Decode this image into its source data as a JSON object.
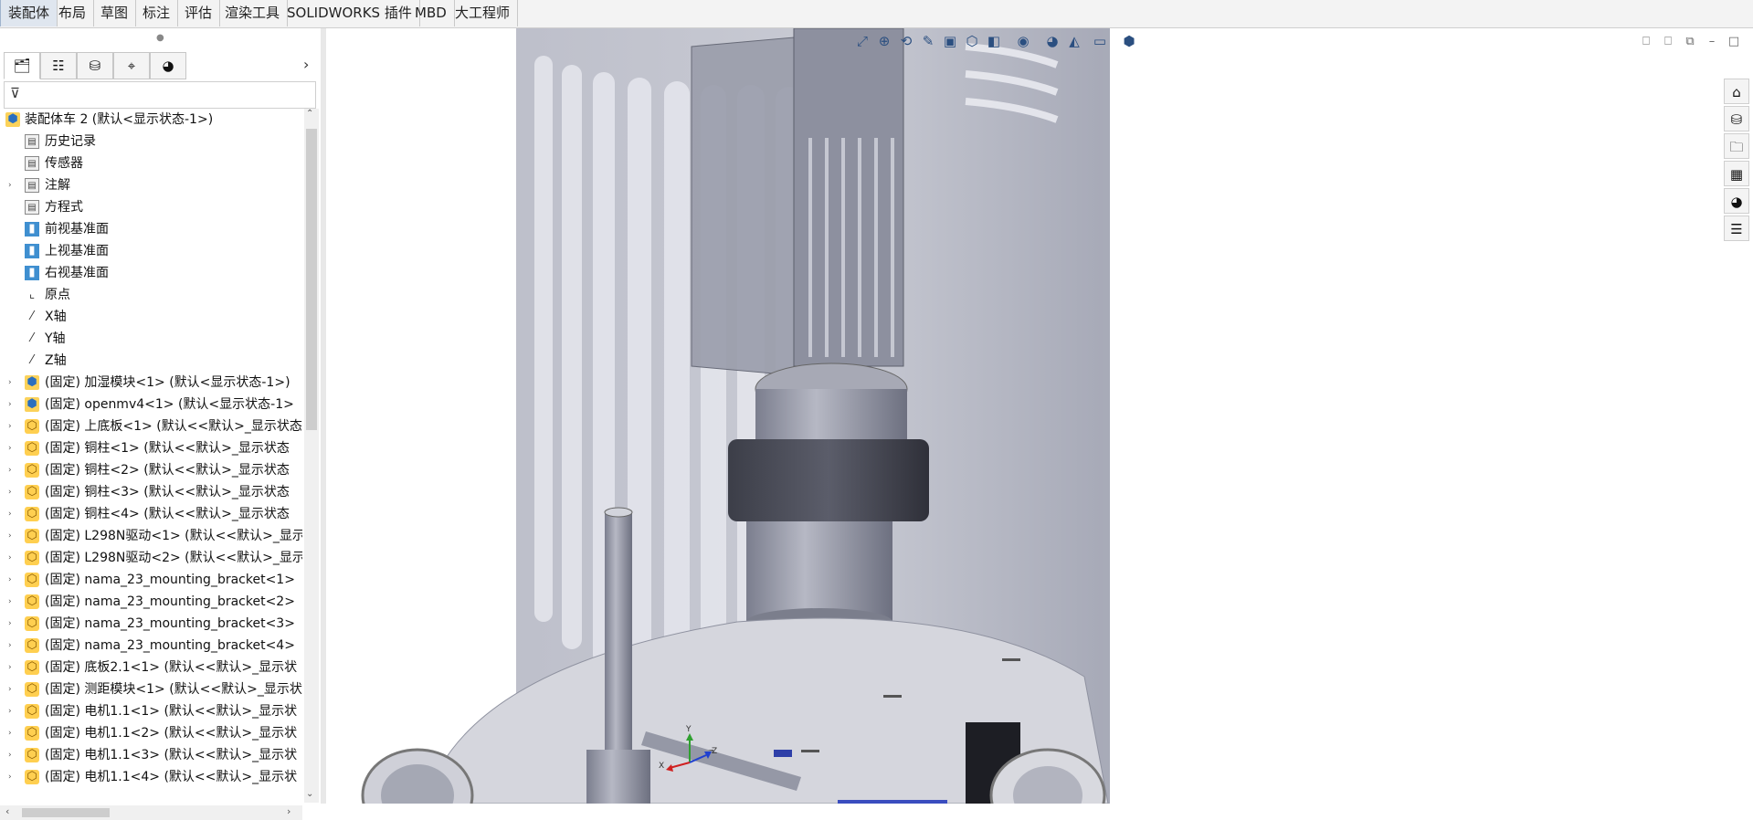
{
  "command_tabs": [
    "装配体",
    "布局",
    "草图",
    "标注",
    "评估",
    "渲染工具",
    "SOLIDWORKS 插件",
    "MBD",
    "大工程师"
  ],
  "active_tab": "装配体",
  "panel_tabs": [
    {
      "name": "featuremanager-tab",
      "icon": "🗂"
    },
    {
      "name": "propertymanager-tab",
      "icon": "☷"
    },
    {
      "name": "configurationmanager-tab",
      "icon": "⛁"
    },
    {
      "name": "dimxpert-tab",
      "icon": "⌖"
    },
    {
      "name": "appearance-tab",
      "icon": "◕"
    }
  ],
  "panel_more_glyph": "›",
  "filter_glyph": "⊽",
  "tree": [
    {
      "label": "装配体车 2 (默认<显示状态-1>)",
      "type": "asm",
      "expand": "",
      "level": 0
    },
    {
      "label": "历史记录",
      "type": "folder",
      "expand": "",
      "level": 1
    },
    {
      "label": "传感器",
      "type": "folder",
      "expand": "",
      "level": 1
    },
    {
      "label": "注解",
      "type": "folder",
      "expand": "›",
      "level": 1
    },
    {
      "label": "方程式",
      "type": "folder",
      "expand": "",
      "level": 1
    },
    {
      "label": "前视基准面",
      "type": "plane",
      "expand": "",
      "level": 1
    },
    {
      "label": "上视基准面",
      "type": "plane",
      "expand": "",
      "level": 1
    },
    {
      "label": "右视基准面",
      "type": "plane",
      "expand": "",
      "level": 1
    },
    {
      "label": "原点",
      "type": "origin",
      "expand": "",
      "level": 1
    },
    {
      "label": "X轴",
      "type": "axis",
      "expand": "",
      "level": 1
    },
    {
      "label": "Y轴",
      "type": "axis",
      "expand": "",
      "level": 1
    },
    {
      "label": "Z轴",
      "type": "axis",
      "expand": "",
      "level": 1
    },
    {
      "label": "(固定) 加湿模块<1> (默认<显示状态-1>)",
      "type": "asm",
      "expand": "›",
      "level": 1
    },
    {
      "label": "(固定) openmv4<1> (默认<显示状态-1>",
      "type": "asm",
      "expand": "›",
      "level": 1
    },
    {
      "label": "(固定) 上底板<1> (默认<<默认>_显示状态",
      "type": "part",
      "expand": "›",
      "level": 1
    },
    {
      "label": "(固定) 铜柱<1> (默认<<默认>_显示状态",
      "type": "part",
      "expand": "›",
      "level": 1
    },
    {
      "label": "(固定) 铜柱<2> (默认<<默认>_显示状态",
      "type": "part",
      "expand": "›",
      "level": 1
    },
    {
      "label": "(固定) 铜柱<3> (默认<<默认>_显示状态",
      "type": "part",
      "expand": "›",
      "level": 1
    },
    {
      "label": "(固定) 铜柱<4> (默认<<默认>_显示状态",
      "type": "part",
      "expand": "›",
      "level": 1
    },
    {
      "label": "(固定) L298N驱动<1> (默认<<默认>_显示",
      "type": "part",
      "expand": "›",
      "level": 1
    },
    {
      "label": "(固定) L298N驱动<2> (默认<<默认>_显示",
      "type": "part",
      "expand": "›",
      "level": 1
    },
    {
      "label": "(固定) nama_23_mounting_bracket<1>",
      "type": "part",
      "expand": "›",
      "level": 1
    },
    {
      "label": "(固定) nama_23_mounting_bracket<2>",
      "type": "part",
      "expand": "›",
      "level": 1
    },
    {
      "label": "(固定) nama_23_mounting_bracket<3>",
      "type": "part",
      "expand": "›",
      "level": 1
    },
    {
      "label": "(固定) nama_23_mounting_bracket<4>",
      "type": "part",
      "expand": "›",
      "level": 1
    },
    {
      "label": "(固定) 底板2.1<1> (默认<<默认>_显示状",
      "type": "part",
      "expand": "›",
      "level": 1
    },
    {
      "label": "(固定) 测距模块<1> (默认<<默认>_显示状",
      "type": "part",
      "expand": "›",
      "level": 1
    },
    {
      "label": "(固定) 电机1.1<1> (默认<<默认>_显示状",
      "type": "part",
      "expand": "›",
      "level": 1
    },
    {
      "label": "(固定) 电机1.1<2> (默认<<默认>_显示状",
      "type": "part",
      "expand": "›",
      "level": 1
    },
    {
      "label": "(固定) 电机1.1<3> (默认<<默认>_显示状",
      "type": "part",
      "expand": "›",
      "level": 1
    },
    {
      "label": "(固定) 电机1.1<4> (默认<<默认>_显示状",
      "type": "part",
      "expand": "›",
      "level": 1
    }
  ],
  "headsup_icons": [
    {
      "name": "zoom-to-fit-icon",
      "glyph": "⤢"
    },
    {
      "name": "zoom-to-area-icon",
      "glyph": "⊕"
    },
    {
      "name": "previous-view-icon",
      "glyph": "⟲"
    },
    {
      "name": "dynamic-annotation-icon",
      "glyph": "✎"
    },
    {
      "name": "section-view-icon",
      "glyph": "▣"
    },
    {
      "name": "view-orientation-icon",
      "glyph": "⬡"
    },
    {
      "name": "display-style-icon",
      "glyph": "◧"
    },
    {
      "name": "hide-show-items-icon",
      "glyph": "◉"
    },
    {
      "name": "edit-appearance-icon",
      "glyph": "◕"
    },
    {
      "name": "apply-scene-icon",
      "glyph": "◭"
    },
    {
      "name": "view-settings-icon",
      "glyph": "▭"
    },
    {
      "name": "3d-cube-icon",
      "glyph": "⬢"
    }
  ],
  "window_controls": [
    {
      "name": "tile-left-icon",
      "glyph": "⎕"
    },
    {
      "name": "tile-right-icon",
      "glyph": "⎕"
    },
    {
      "name": "restore-icon",
      "glyph": "⧉"
    },
    {
      "name": "minimize-icon",
      "glyph": "–"
    },
    {
      "name": "maximize-icon",
      "glyph": "□"
    }
  ],
  "task_pane": [
    {
      "name": "solidworks-resources-icon",
      "glyph": "⌂"
    },
    {
      "name": "design-library-icon",
      "glyph": "⛁"
    },
    {
      "name": "file-explorer-icon",
      "glyph": "🗀"
    },
    {
      "name": "view-palette-icon",
      "glyph": "▦"
    },
    {
      "name": "appearances-scenes-icon",
      "glyph": "◕"
    },
    {
      "name": "custom-properties-icon",
      "glyph": "☰"
    }
  ],
  "triad": {
    "x": "X",
    "y": "Y",
    "z": "Z"
  },
  "colors": {
    "accent": "#2b4f80",
    "active_tab": "#dfe6ef",
    "panel_bg": "#ffffff",
    "model_gray": "#8c8f9e",
    "housing": "#b8bac6"
  }
}
